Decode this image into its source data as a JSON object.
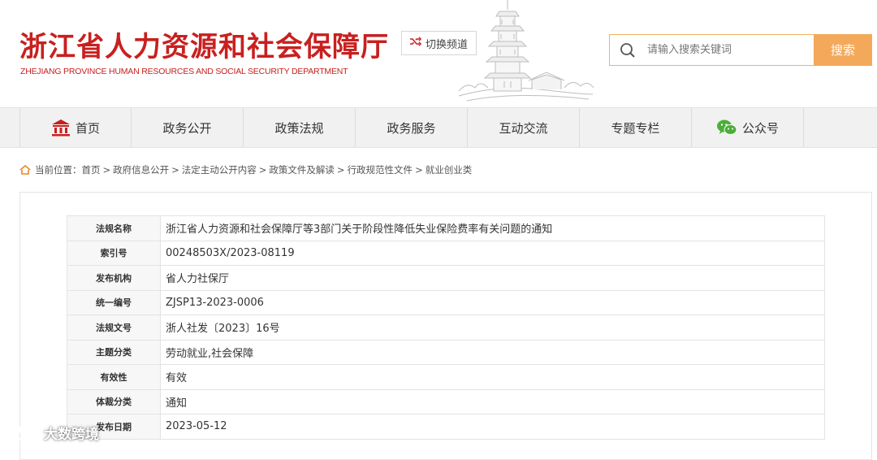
{
  "header": {
    "title_cn": "浙江省人力资源和社会保障厅",
    "title_en": "ZHEJIANG PROVINCE HUMAN RESOURCES AND SOCIAL SECURITY DEPARTMENT",
    "switch_channel_label": "切换频道",
    "search_placeholder": "请输入搜索关键词",
    "search_button": "搜索"
  },
  "nav": {
    "items": [
      {
        "label": "首页",
        "icon": "home-building-icon"
      },
      {
        "label": "政务公开"
      },
      {
        "label": "政策法规"
      },
      {
        "label": "政务服务"
      },
      {
        "label": "互动交流"
      },
      {
        "label": "专题专栏"
      },
      {
        "label": "公众号",
        "icon": "wechat-icon"
      }
    ]
  },
  "breadcrumb": {
    "prefix": "当前位置：",
    "items": [
      "首页",
      "政府信息公开",
      "法定主动公开内容",
      "政策文件及解读",
      "行政规范性文件",
      "就业创业类"
    ],
    "separator": ">"
  },
  "meta_table": {
    "rows": [
      {
        "label": "法规名称",
        "value": "浙江省人力资源和社会保障厅等3部门关于阶段性降低失业保险费率有关问题的通知"
      },
      {
        "label": "索引号",
        "value": "00248503X/2023-08119"
      },
      {
        "label": "发布机构",
        "value": "省人力社保厅"
      },
      {
        "label": "统一编号",
        "value": "ZJSP13-2023-0006"
      },
      {
        "label": "法规文号",
        "value": "浙人社发〔2023〕16号"
      },
      {
        "label": "主题分类",
        "value": "劳动就业,社会保障"
      },
      {
        "label": "有效性",
        "value": "有效"
      },
      {
        "label": "体裁分类",
        "value": "通知"
      },
      {
        "label": "发布日期",
        "value": "2023-05-12"
      }
    ]
  },
  "watermark": {
    "text": "大数跨境"
  },
  "colors": {
    "brand_red": "#c8201f",
    "search_orange": "#f4a95a",
    "nav_bg": "#f1f1f1"
  }
}
